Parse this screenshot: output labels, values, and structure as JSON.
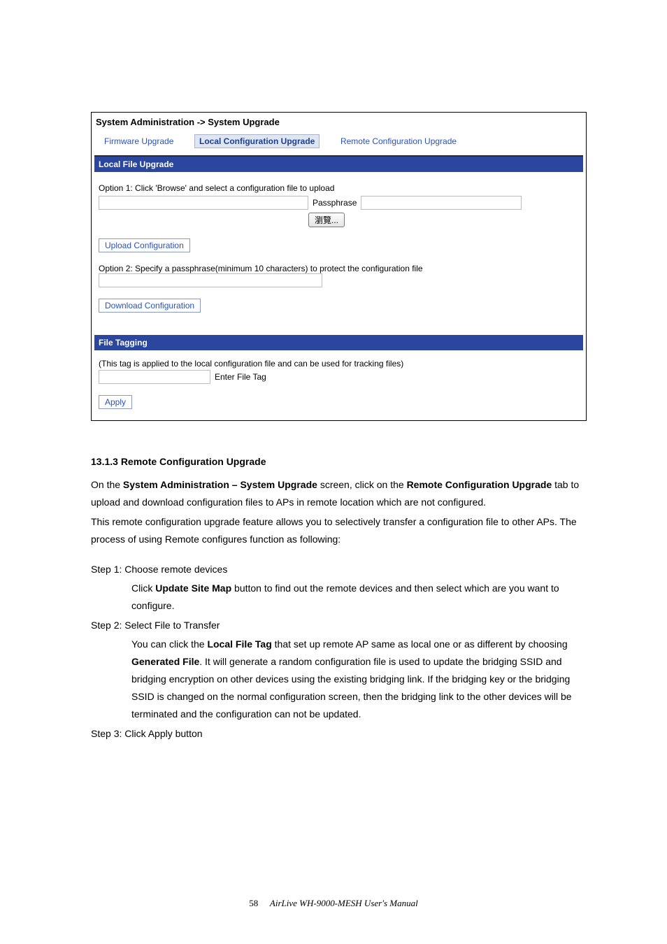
{
  "ui": {
    "title": "System Administration -> System Upgrade",
    "tabs": {
      "firmware": "Firmware Upgrade",
      "local": "Local Configuration Upgrade",
      "remote": "Remote Configuration Upgrade"
    },
    "local_upgrade": {
      "header": "Local File Upgrade",
      "option1_text": "Option 1: Click 'Browse' and select a configuration file to upload",
      "passphrase_label": "Passphrase",
      "browse_btn": "瀏覽...",
      "upload_btn": "Upload Configuration",
      "option2_text": "Option 2: Specify a passphrase(minimum 10 characters) to protect the configuration file",
      "download_btn": "Download Configuration"
    },
    "file_tagging": {
      "header": "File Tagging",
      "desc": "(This tag is applied to the local configuration file and can be used for tracking files)",
      "label": "Enter File Tag",
      "apply_btn": "Apply"
    }
  },
  "doc": {
    "h": "13.1.3 Remote Configuration Upgrade",
    "p1a": "On the ",
    "p1b": "System Administration – System Upgrade",
    "p1c": " screen, click on the ",
    "p1d": "Remote Configuration Upgrade",
    "p1e": " tab to upload and download configuration files to APs in remote location which are not configured.",
    "p2": "This remote configuration upgrade feature allows you to selectively transfer a configuration file to other APs. The process of using Remote configures function as following:",
    "s1_head": "Step 1: Choose remote devices",
    "s1_a": "Click ",
    "s1_b": "Update Site Map",
    "s1_c": " button to find out the remote devices and then select which are you want to configure.",
    "s2_head": "Step 2: Select File to Transfer",
    "s2_a": "You can click the ",
    "s2_b": "Local File Tag",
    "s2_c": " that set up remote AP same as local one or as different by choosing ",
    "s2_d": "Generated File",
    "s2_e": ". It will generate a random configuration file is used to update the bridging SSID and bridging encryption on other devices using the existing bridging link. If the bridging key or the bridging SSID is changed on the normal configuration screen, then the bridging link to the other devices will be terminated and the configuration can not be updated.",
    "s3_head": "Step 3: Click Apply button"
  },
  "footer": {
    "page": "58",
    "title": "AirLive  WH-9000-MESH  User's  Manual"
  }
}
